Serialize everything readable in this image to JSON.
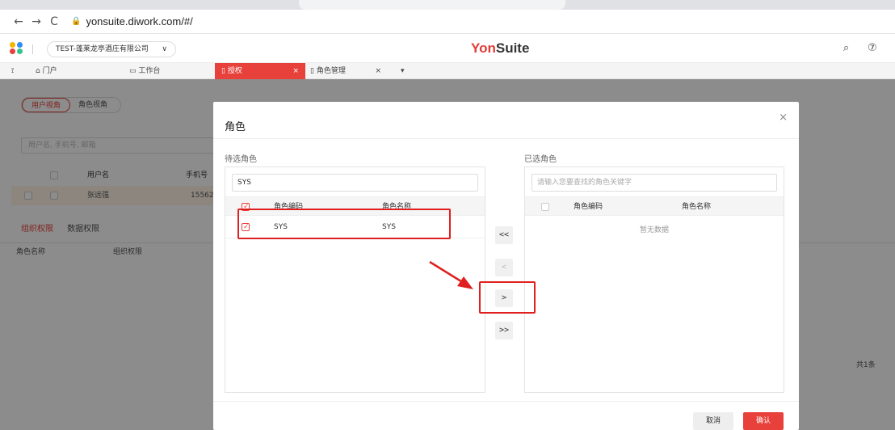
{
  "browser": {
    "back_glyph": "←",
    "forward_glyph": "→",
    "reload_glyph": "C",
    "lock_glyph": "🔒",
    "url": "yonsuite.diwork.com/#/"
  },
  "header": {
    "org_name": "TEST-蓬莱龙亭酒庄有限公司",
    "org_chevron": "∨",
    "brand_part1": "Yon",
    "brand_part2": "Suite",
    "search_glyph": "⌕",
    "help_glyph": "⑦",
    "logo_colors": [
      "#f7b500",
      "#2e8df2",
      "#e8403a",
      "#34c38f"
    ]
  },
  "tabs": {
    "home_glyph": "⟟",
    "portal_label": "⌂ 门户",
    "workbench_label": "▭ 工作台",
    "auth_tab_label": "▯ 授权",
    "auth_tab_close": "×",
    "role_tab_label": "▯ 角色管理",
    "role_tab_close": "×",
    "more_glyph": "▾"
  },
  "background": {
    "view_user": "用户视角",
    "view_role": "角色视角",
    "search_placeholder": "用户名, 手机号, 邮箱",
    "col_username": "用户名",
    "col_phone": "手机号",
    "row_name": "张远强",
    "row_phone": "15562",
    "subtab_org": "组织权限",
    "subtab_data": "数据权限",
    "col_role_name": "角色名称",
    "col_org_perm": "组织权限",
    "total_text": "共1条"
  },
  "modal": {
    "title": "角色",
    "close_glyph": "×",
    "left_label": "待选角色",
    "left_search_value": "SYS",
    "right_label": "已选角色",
    "right_search_placeholder": "请输入您要查找的角色关键字",
    "col_code": "角色编码",
    "col_name": "角色名称",
    "candidate_rows": [
      {
        "code": "SYS",
        "name": "SYS",
        "checked": true
      }
    ],
    "empty_text": "暂无数据",
    "transfer_buttons": [
      "<<",
      "<",
      ">",
      ">>"
    ],
    "cancel_label": "取消",
    "ok_label": "确认"
  },
  "colors": {
    "accent": "#e8403a",
    "annotation": "#e02020"
  }
}
